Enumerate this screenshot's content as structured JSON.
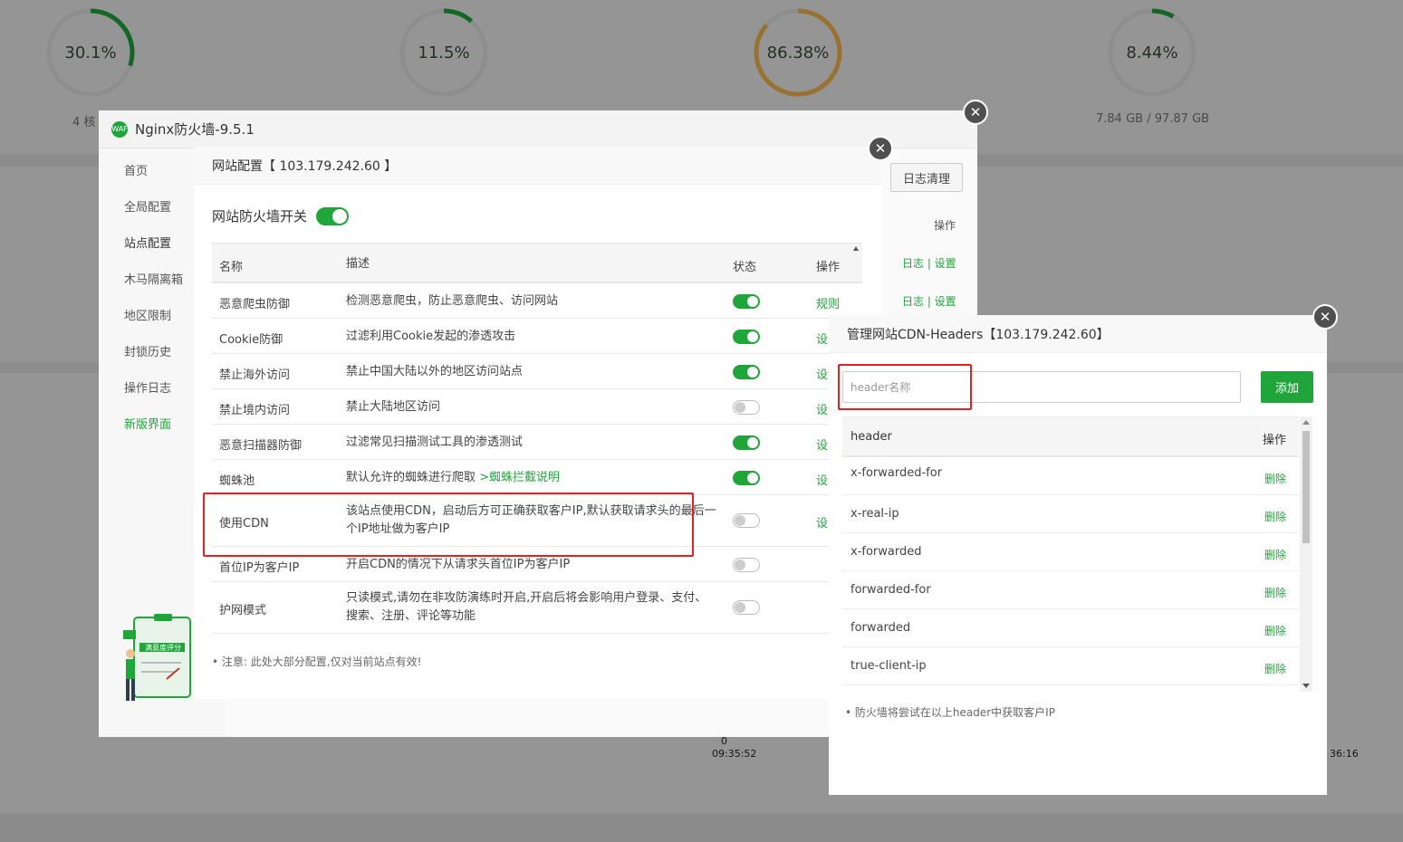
{
  "dashboard": {
    "gauges": [
      {
        "value": "30.1%",
        "sub": "4 核",
        "percent": 30.1,
        "color": "#20a53a"
      },
      {
        "value": "11.5%",
        "sub": "",
        "percent": 11.5,
        "color": "#20a53a"
      },
      {
        "value": "86.38%",
        "sub": "",
        "percent": 86.38,
        "color": "#f7b851"
      },
      {
        "value": "8.44%",
        "sub": "7.84 GB / 97.87 GB",
        "percent": 8.44,
        "color": "#20a53a"
      }
    ],
    "axis": {
      "zero": "0",
      "time_start": "09:35:52",
      "time_end": "36:16"
    }
  },
  "firewall": {
    "title": "Nginx防火墙-9.5.1",
    "shield_text": "WAF",
    "nav": [
      "首页",
      "全局配置",
      "站点配置",
      "木马隔离箱",
      "地区限制",
      "封锁历史",
      "操作日志",
      "新版界面"
    ],
    "log_clean_btn": "日志清理",
    "col_op": "操作",
    "row_links": [
      "日志 | 设置",
      "日志 | 设置"
    ],
    "illustration_text": "满意度评分"
  },
  "site_config": {
    "title": "网站配置【 103.179.242.60 】",
    "switch_label": "网站防火墙开关",
    "switch_on": true,
    "columns": {
      "name": "名称",
      "desc": "描述",
      "state": "状态",
      "op": "操作"
    },
    "rows": [
      {
        "name": "恶意爬虫防御",
        "desc": "检测恶意爬虫，防止恶意爬虫、访问网站",
        "link": "",
        "on": true,
        "op": "规则"
      },
      {
        "name": "Cookie防御",
        "desc": "过滤利用Cookie发起的渗透攻击",
        "link": "",
        "on": true,
        "op": "设"
      },
      {
        "name": "禁止海外访问",
        "desc": "禁止中国大陆以外的地区访问站点",
        "link": "",
        "on": true,
        "op": "设"
      },
      {
        "name": "禁止境内访问",
        "desc": "禁止大陆地区访问",
        "link": "",
        "on": false,
        "op": "设"
      },
      {
        "name": "恶意扫描器防御",
        "desc": "过滤常见扫描测试工具的渗透测试",
        "link": "",
        "on": true,
        "op": "设"
      },
      {
        "name": "蜘蛛池",
        "desc": "默认允许的蜘蛛进行爬取 ",
        "link": ">蜘蛛拦截说明",
        "on": true,
        "op": "设"
      },
      {
        "name": "使用CDN",
        "desc": "该站点使用CDN，启动后方可正确获取客户IP,默认获取请求头的最后一个IP地址做为客户IP",
        "link": "",
        "on": false,
        "op": "设"
      },
      {
        "name": "首位IP为客户IP",
        "desc": "开启CDN的情况下从请求头首位IP为客户IP",
        "link": "",
        "on": false,
        "op": ""
      },
      {
        "name": "护网模式",
        "desc": "只读模式,请勿在非攻防演练时开启,开启后将会影响用户登录、支付、搜索、注册、评论等功能",
        "link": "",
        "on": false,
        "op": ""
      }
    ],
    "note": "注意: 此处大部分配置,仅对当前站点有效!"
  },
  "cdn_dialog": {
    "title": "管理网站CDN-Headers【103.179.242.60】",
    "input_placeholder": "header名称",
    "input_value": "",
    "add_btn": "添加",
    "col_header": "header",
    "col_op": "操作",
    "rows": [
      {
        "name": "x-forwarded-for",
        "op": "删除"
      },
      {
        "name": "x-real-ip",
        "op": "删除"
      },
      {
        "name": "x-forwarded",
        "op": "删除"
      },
      {
        "name": "forwarded-for",
        "op": "删除"
      },
      {
        "name": "forwarded",
        "op": "删除"
      },
      {
        "name": "true-client-ip",
        "op": "删除"
      },
      {
        "name": "",
        "op": ""
      }
    ],
    "note": "防火墙将尝试在以上header中获取客户IP"
  }
}
